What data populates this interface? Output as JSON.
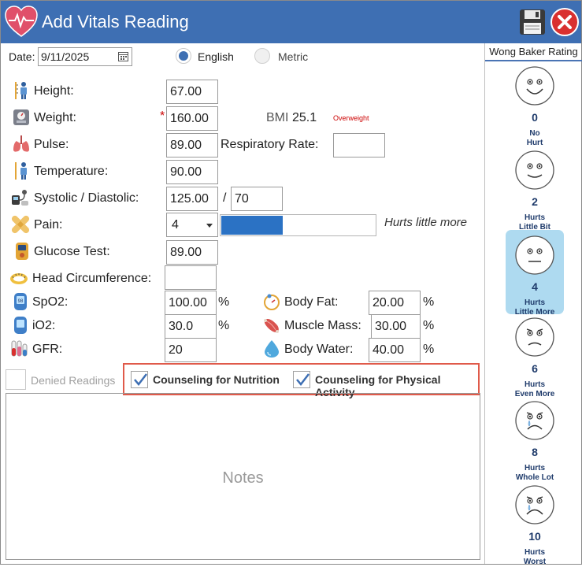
{
  "window": {
    "title": "Add Vitals Reading"
  },
  "date": {
    "label": "Date:",
    "value": "9/11/2025"
  },
  "units": {
    "options": [
      {
        "label": "English",
        "selected": true
      },
      {
        "label": "Metric",
        "selected": false
      }
    ]
  },
  "fields": {
    "height": {
      "label": "Height:",
      "value": "67.00"
    },
    "weight": {
      "label": "Weight:",
      "value": "160.00",
      "required_marker": "*"
    },
    "bmi": {
      "label": "BMI",
      "value": "25.1",
      "status": "Overweight",
      "status_color": "#cc0000"
    },
    "pulse": {
      "label": "Pulse:",
      "value": "89.00"
    },
    "respiratory_rate": {
      "label": "Respiratory Rate:",
      "value": ""
    },
    "temperature": {
      "label": "Temperature:",
      "value": "90.00"
    },
    "systolic_diastolic": {
      "label": "Systolic / Diastolic:",
      "systolic": "125.00",
      "separator": "/",
      "diastolic": "70"
    },
    "pain": {
      "label": "Pain:",
      "value": "4",
      "level_fraction": 0.4,
      "description": "Hurts little more",
      "bar_color": "#2b72c4"
    },
    "glucose": {
      "label": "Glucose Test:",
      "value": "89.00"
    },
    "head_circumference": {
      "label": "Head Circumference:",
      "value": ""
    },
    "spo2": {
      "label": "SpO2:",
      "value": "100.00",
      "unit": "%"
    },
    "io2": {
      "label": "iO2:",
      "value": "30.0",
      "unit": "%"
    },
    "gfr": {
      "label": "GFR:",
      "value": "20"
    },
    "body_fat": {
      "label": "Body Fat:",
      "value": "20.00",
      "unit": "%"
    },
    "muscle_mass": {
      "label": "Muscle Mass:",
      "value": "30.00",
      "unit": "%"
    },
    "body_water": {
      "label": "Body Water:",
      "value": "40.00",
      "unit": "%"
    }
  },
  "checkboxes": {
    "denied": {
      "label": "Denied Readings",
      "checked": false
    },
    "nutrition": {
      "label": "Counseling for Nutrition",
      "checked": true
    },
    "activity": {
      "label": "Counseling for Physical Activity",
      "checked": true
    }
  },
  "notes": {
    "placeholder": "Notes"
  },
  "wong_baker": {
    "title": "Wong Baker Rating",
    "faces": [
      {
        "num": "0",
        "caption1": "No",
        "caption2": "Hurt",
        "selected": false
      },
      {
        "num": "2",
        "caption1": "Hurts",
        "caption2": "Little Bit",
        "selected": false
      },
      {
        "num": "4",
        "caption1": "Hurts",
        "caption2": "Little More",
        "selected": true
      },
      {
        "num": "6",
        "caption1": "Hurts",
        "caption2": "Even More",
        "selected": false
      },
      {
        "num": "8",
        "caption1": "Hurts",
        "caption2": "Whole Lot",
        "selected": false
      },
      {
        "num": "10",
        "caption1": "Hurts",
        "caption2": "Worst",
        "selected": false
      }
    ]
  },
  "colors": {
    "titlebar": "#3e6fb3",
    "accent": "#2b72c4",
    "highlight_border": "#e05a4a"
  }
}
